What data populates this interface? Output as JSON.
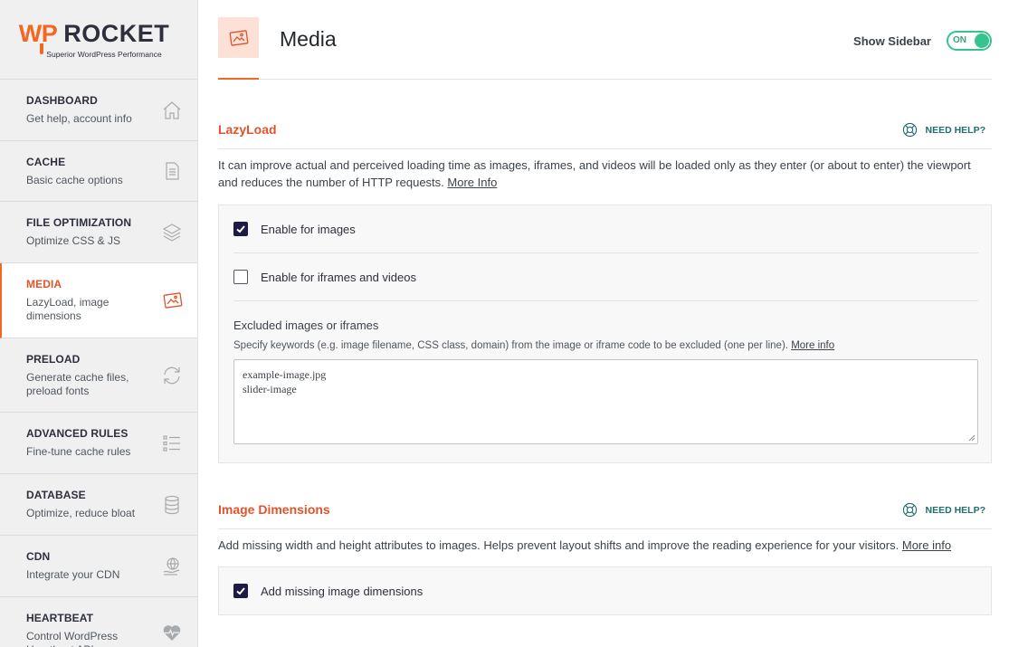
{
  "logo": {
    "brand_wp": "WP",
    "brand_rocket": "ROCKET",
    "tagline": "Superior WordPress Performance"
  },
  "sidebar": {
    "items": [
      {
        "title": "DASHBOARD",
        "desc": "Get help, account info",
        "icon": "home-icon"
      },
      {
        "title": "CACHE",
        "desc": "Basic cache options",
        "icon": "file-icon"
      },
      {
        "title": "FILE OPTIMIZATION",
        "desc": "Optimize CSS & JS",
        "icon": "layers-icon"
      },
      {
        "title": "MEDIA",
        "desc": "LazyLoad, image dimensions",
        "icon": "image-icon"
      },
      {
        "title": "PRELOAD",
        "desc": "Generate cache files, preload fonts",
        "icon": "refresh-icon"
      },
      {
        "title": "ADVANCED RULES",
        "desc": "Fine-tune cache rules",
        "icon": "list-icon"
      },
      {
        "title": "DATABASE",
        "desc": "Optimize, reduce bloat",
        "icon": "database-icon"
      },
      {
        "title": "CDN",
        "desc": "Integrate your CDN",
        "icon": "cdn-icon"
      },
      {
        "title": "HEARTBEAT",
        "desc": "Control WordPress Heartbeat API",
        "icon": "heart-icon"
      }
    ]
  },
  "header": {
    "title": "Media",
    "show_sidebar_label": "Show Sidebar",
    "toggle_state": "ON"
  },
  "lazyload": {
    "title": "LazyLoad",
    "need_help": "NEED HELP?",
    "desc": "It can improve actual and perceived loading time as images, iframes, and videos will be loaded only as they enter (or about to enter) the viewport and reduces the number of HTTP requests.",
    "more_info": "More Info",
    "opt_images": "Enable for images",
    "opt_images_checked": true,
    "opt_iframes": "Enable for iframes and videos",
    "opt_iframes_checked": false,
    "excluded_label": "Excluded images or iframes",
    "excluded_desc": "Specify keywords (e.g. image filename, CSS class, domain) from the image or iframe code to be excluded (one per line).",
    "excluded_more": "More info",
    "excluded_lines": [
      "example-image.jpg",
      "slider-image"
    ]
  },
  "dimensions": {
    "title": "Image Dimensions",
    "need_help": "NEED HELP?",
    "desc": "Add missing width and height attributes to images. Helps prevent layout shifts and improve the reading experience for your visitors.",
    "more_info": "More info",
    "opt_add": "Add missing image dimensions",
    "opt_add_checked": true
  },
  "colors": {
    "accent": "#f26722",
    "section_title": "#e0542c",
    "toggle": "#35c48e",
    "checkbox": "#1d1b44",
    "help": "#1f6f6e"
  }
}
